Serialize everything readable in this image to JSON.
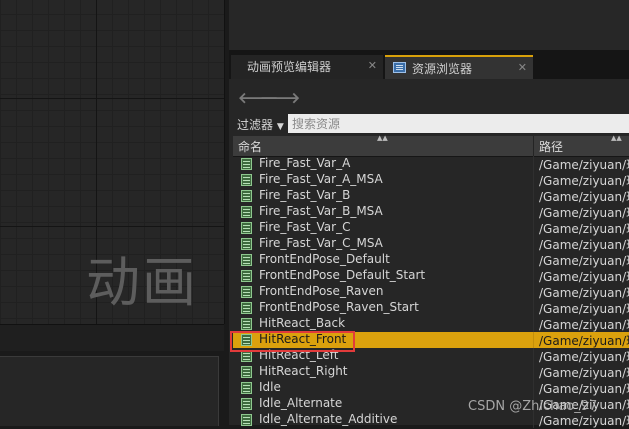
{
  "viewport": {
    "label": "动画"
  },
  "tabs": [
    {
      "label": "动画预览编辑器",
      "active": false
    },
    {
      "label": "资源浏览器",
      "active": true
    }
  ],
  "nav": {
    "back_icon": "arrow-left-icon",
    "forward_icon": "arrow-right-icon"
  },
  "filter": {
    "label": "过滤器",
    "search_placeholder": "搜索资源"
  },
  "columns": {
    "name": "命名",
    "path": "路径"
  },
  "assets": [
    {
      "name": "Fire_Fast_Var_A",
      "path": "/Game/ziyuan/玩"
    },
    {
      "name": "Fire_Fast_Var_A_MSA",
      "path": "/Game/ziyuan/玩"
    },
    {
      "name": "Fire_Fast_Var_B",
      "path": "/Game/ziyuan/玩"
    },
    {
      "name": "Fire_Fast_Var_B_MSA",
      "path": "/Game/ziyuan/玩"
    },
    {
      "name": "Fire_Fast_Var_C",
      "path": "/Game/ziyuan/玩"
    },
    {
      "name": "Fire_Fast_Var_C_MSA",
      "path": "/Game/ziyuan/玩"
    },
    {
      "name": "FrontEndPose_Default",
      "path": "/Game/ziyuan/玩"
    },
    {
      "name": "FrontEndPose_Default_Start",
      "path": "/Game/ziyuan/玩"
    },
    {
      "name": "FrontEndPose_Raven",
      "path": "/Game/ziyuan/玩"
    },
    {
      "name": "FrontEndPose_Raven_Start",
      "path": "/Game/ziyuan/玩"
    },
    {
      "name": "HitReact_Back",
      "path": "/Game/ziyuan/玩"
    },
    {
      "name": "HitReact_Front",
      "path": "/Game/ziyuan/玩",
      "selected": true
    },
    {
      "name": "HitReact_Left",
      "path": "/Game/ziyuan/玩"
    },
    {
      "name": "HitReact_Right",
      "path": "/Game/ziyuan/玩"
    },
    {
      "name": "Idle",
      "path": "/Game/ziyuan/玩"
    },
    {
      "name": "Idle_Alternate",
      "path": "/Game/ziyuan/玩"
    },
    {
      "name": "Idle_Alternate_Additive",
      "path": "/Game/ziyuan/玩"
    }
  ],
  "watermark": "CSDN @Zhichao_97",
  "colors": {
    "selection": "#dba10d",
    "highlight": "#e23b3b",
    "tab_accent": "#d9a10a"
  }
}
